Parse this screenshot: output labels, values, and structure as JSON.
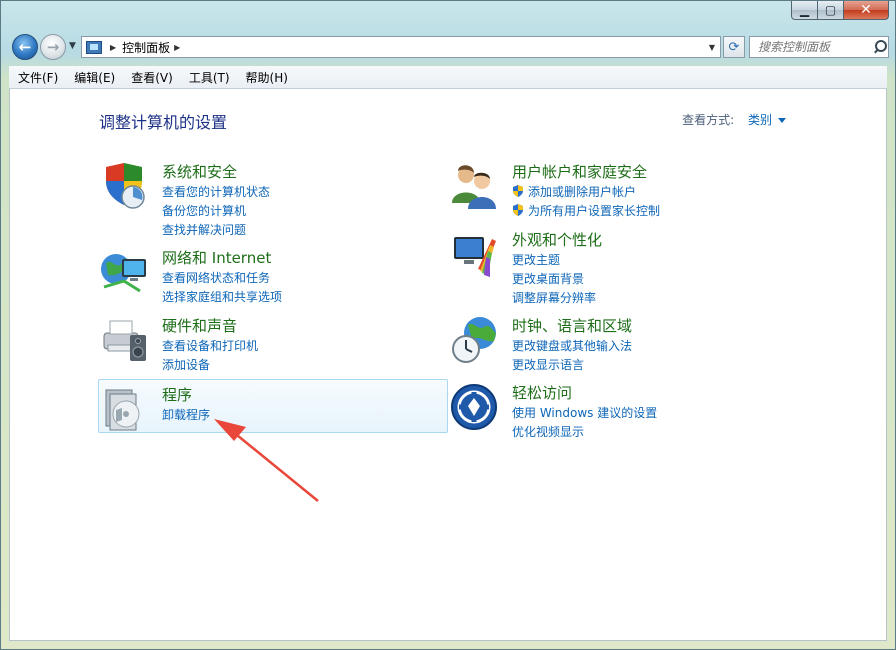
{
  "address": {
    "crumb": "控制面板"
  },
  "search": {
    "placeholder": "搜索控制面板"
  },
  "menubar": {
    "items": [
      "文件(F)",
      "编辑(E)",
      "查看(V)",
      "工具(T)",
      "帮助(H)"
    ]
  },
  "page": {
    "title": "调整计算机的设置",
    "view_label": "查看方式:",
    "view_value": "类别"
  },
  "categories": [
    {
      "title": "系统和安全",
      "icon": "system-security-icon",
      "links": [
        "查看您的计算机状态",
        "备份您的计算机",
        "查找并解决问题"
      ]
    },
    {
      "title": "网络和 Internet",
      "icon": "network-icon",
      "links": [
        "查看网络状态和任务",
        "选择家庭组和共享选项"
      ]
    },
    {
      "title": "硬件和声音",
      "icon": "hardware-sound-icon",
      "links": [
        "查看设备和打印机",
        "添加设备"
      ]
    },
    {
      "title": "程序",
      "icon": "programs-icon",
      "links": [
        "卸载程序"
      ]
    },
    {
      "title": "用户帐户和家庭安全",
      "icon": "user-accounts-icon",
      "links": [
        "添加或删除用户帐户",
        "为所有用户设置家长控制"
      ]
    },
    {
      "title": "外观和个性化",
      "icon": "appearance-icon",
      "links": [
        "更改主题",
        "更改桌面背景",
        "调整屏幕分辨率"
      ]
    },
    {
      "title": "时钟、语言和区域",
      "icon": "clock-language-icon",
      "links": [
        "更改键盘或其他输入法",
        "更改显示语言"
      ]
    },
    {
      "title": "轻松访问",
      "icon": "ease-of-access-icon",
      "links": [
        "使用 Windows 建议的设置",
        "优化视频显示"
      ]
    }
  ],
  "colors": {
    "category_title": "#1e6d18",
    "link": "#0e66b8",
    "page_title": "#1e3287",
    "annotation_arrow": "#e8473a"
  }
}
